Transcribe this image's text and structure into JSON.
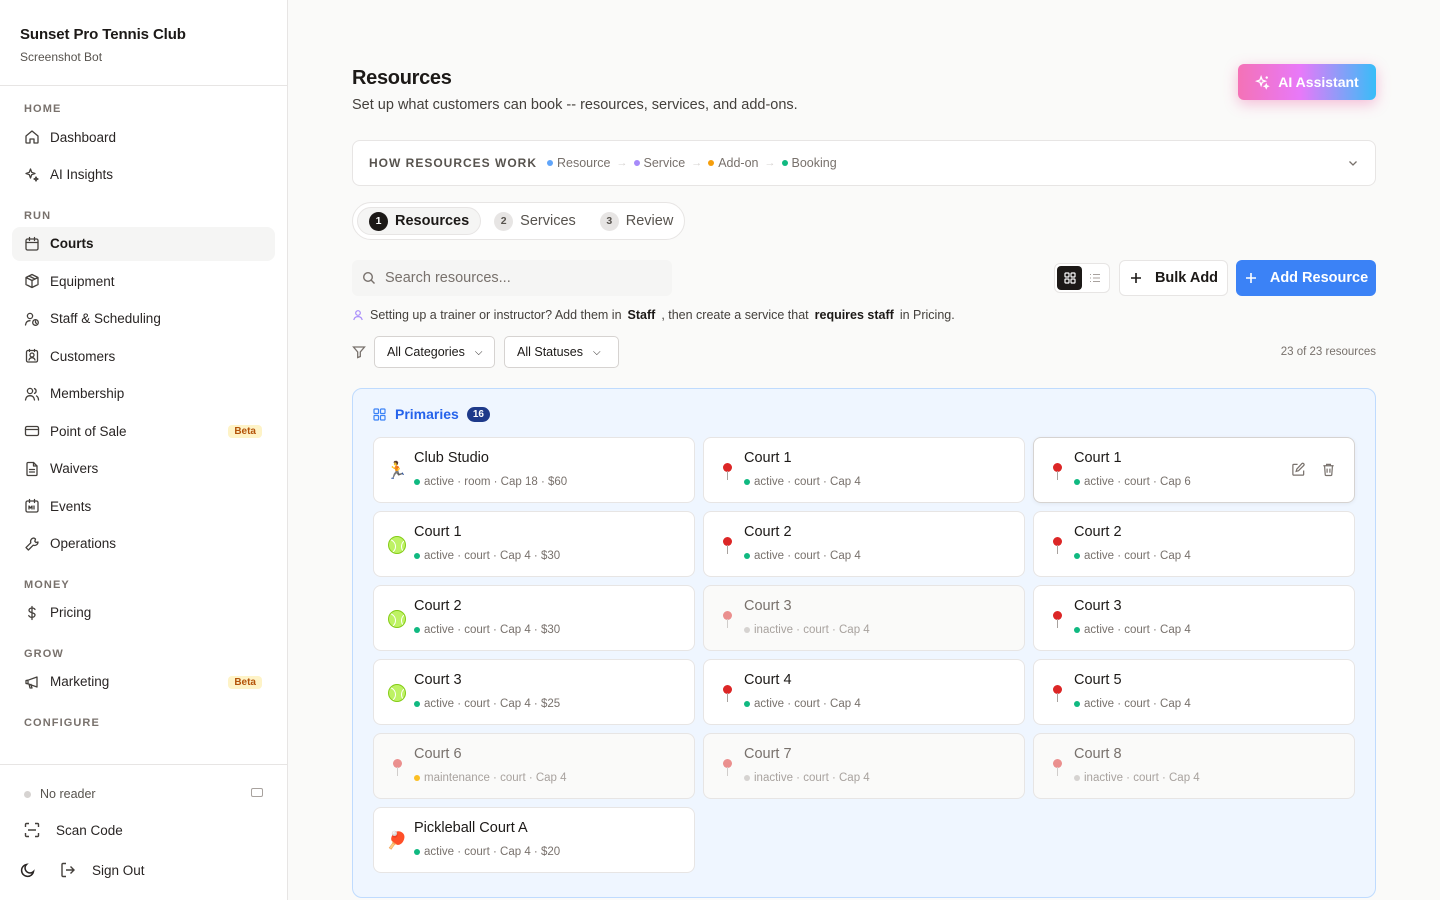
{
  "sidebar": {
    "club_name": "Sunset Pro Tennis Club",
    "user_name": "Screenshot Bot",
    "sections": [
      {
        "label": "HOME",
        "items": [
          {
            "label": "Dashboard",
            "icon": "home-icon"
          },
          {
            "label": "AI Insights",
            "icon": "sparkles-icon"
          }
        ]
      },
      {
        "label": "RUN",
        "items": [
          {
            "label": "Courts",
            "icon": "calendar-icon",
            "active": true
          },
          {
            "label": "Equipment",
            "icon": "box-icon"
          },
          {
            "label": "Staff & Scheduling",
            "icon": "user-clock-icon"
          },
          {
            "label": "Customers",
            "icon": "contact-icon"
          },
          {
            "label": "Membership",
            "icon": "users-icon"
          },
          {
            "label": "Point of Sale",
            "icon": "credit-card-icon",
            "badge": "Beta"
          },
          {
            "label": "Waivers",
            "icon": "document-icon"
          },
          {
            "label": "Events",
            "icon": "calendar-events-icon"
          },
          {
            "label": "Operations",
            "icon": "wrench-icon"
          }
        ]
      },
      {
        "label": "MONEY",
        "items": [
          {
            "label": "Pricing",
            "icon": "dollar-icon"
          }
        ]
      },
      {
        "label": "GROW",
        "items": [
          {
            "label": "Marketing",
            "icon": "megaphone-icon",
            "badge": "Beta"
          }
        ]
      },
      {
        "label": "CONFIGURE",
        "items": []
      }
    ],
    "reader_status": "No reader",
    "scan_label": "Scan Code",
    "sign_out_label": "Sign Out"
  },
  "header": {
    "title": "Resources",
    "description": "Set up what customers can book -- resources, services, and add-ons.",
    "ai_button": "AI Assistant"
  },
  "how": {
    "title": "HOW RESOURCES WORK",
    "steps": [
      {
        "label": "Resource",
        "color": "#60a5fa"
      },
      {
        "label": "Service",
        "color": "#a78bfa"
      },
      {
        "label": "Add-on",
        "color": "#f59e0b"
      },
      {
        "label": "Booking",
        "color": "#10b981"
      }
    ]
  },
  "stepper": [
    {
      "num": "1",
      "label": "Resources",
      "active": true
    },
    {
      "num": "2",
      "label": "Services"
    },
    {
      "num": "3",
      "label": "Review"
    }
  ],
  "toolbar": {
    "search_placeholder": "Search resources...",
    "bulk_add": "Bulk Add",
    "add_resource": "Add Resource"
  },
  "hint": {
    "prefix": "Setting up a trainer or instructor? Add them in",
    "staff": "Staff",
    "middle": ", then create a service that",
    "requires": "requires staff",
    "suffix": "in Pricing."
  },
  "filters": {
    "category": "All Categories",
    "status": "All Statuses",
    "count": "23 of 23 resources"
  },
  "group": {
    "name": "Primaries",
    "count": "16",
    "cards": [
      {
        "name": "Club Studio",
        "icon": "runner",
        "status": "active",
        "meta": "active · room · Cap 18 · $60"
      },
      {
        "name": "Court 1",
        "icon": "pin",
        "status": "active",
        "meta": "active · court · Cap 4"
      },
      {
        "name": "Court 1",
        "icon": "pin",
        "status": "active",
        "meta": "active · court · Cap 6",
        "hover": true
      },
      {
        "name": "Court 1",
        "icon": "ball",
        "status": "active",
        "meta": "active · court · Cap 4 · $30"
      },
      {
        "name": "Court 2",
        "icon": "pin",
        "status": "active",
        "meta": "active · court · Cap 4"
      },
      {
        "name": "Court 2",
        "icon": "pin",
        "status": "active",
        "meta": "active · court · Cap 4"
      },
      {
        "name": "Court 2",
        "icon": "ball",
        "status": "active",
        "meta": "active · court · Cap 4 · $30"
      },
      {
        "name": "Court 3",
        "icon": "pin",
        "status": "inactive",
        "meta": "inactive · court · Cap 4"
      },
      {
        "name": "Court 3",
        "icon": "pin",
        "status": "active",
        "meta": "active · court · Cap 4"
      },
      {
        "name": "Court 3",
        "icon": "ball",
        "status": "active",
        "meta": "active · court · Cap 4 · $25"
      },
      {
        "name": "Court 4",
        "icon": "pin",
        "status": "active",
        "meta": "active · court · Cap 4"
      },
      {
        "name": "Court 5",
        "icon": "pin",
        "status": "active",
        "meta": "active · court · Cap 4"
      },
      {
        "name": "Court 6",
        "icon": "pin",
        "status": "maintenance",
        "meta": "maintenance · court · Cap 4"
      },
      {
        "name": "Court 7",
        "icon": "pin",
        "status": "inactive",
        "meta": "inactive · court · Cap 4"
      },
      {
        "name": "Court 8",
        "icon": "pin",
        "status": "inactive",
        "meta": "inactive · court · Cap 4"
      },
      {
        "name": "Pickleball Court A",
        "icon": "paddle",
        "status": "active",
        "meta": "active · court · Cap 4 · $20"
      }
    ]
  },
  "colors": {
    "status_active": "#10b981",
    "status_inactive": "#d6d3d1",
    "status_maintenance": "#fbbf24",
    "primary": "#3b82f6"
  }
}
